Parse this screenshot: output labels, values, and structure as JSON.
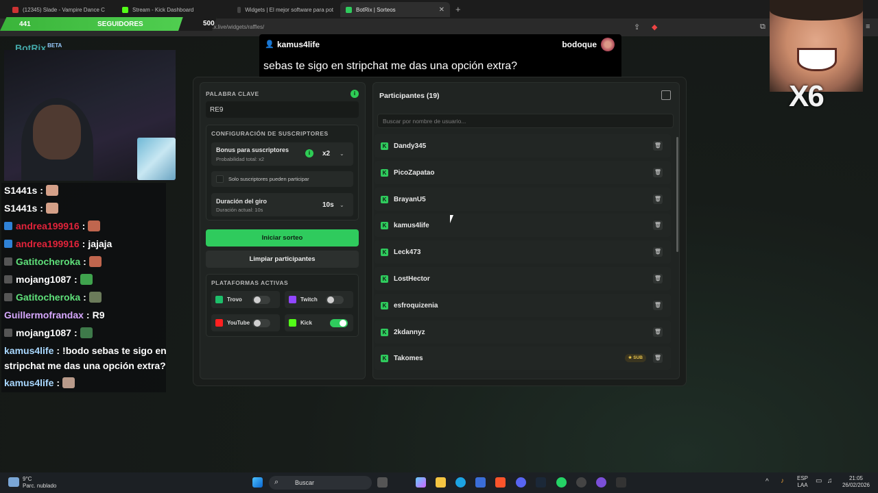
{
  "browser": {
    "tabs": [
      {
        "label": "(12345) Slade - Vampire Dance C"
      },
      {
        "label": "Stream - Kick Dashboard"
      },
      {
        "label": "Widgets | El mejor software para pot"
      },
      {
        "label": "BotRix | Sorteos"
      }
    ],
    "url": "botrix.live/widgets/raffles/"
  },
  "overlay": {
    "followers_count": "441",
    "followers_label": "SEGUIDORES",
    "followers_goal": "500",
    "logo": "BotRix",
    "logo_tag": "BETA",
    "multiplier": "X6"
  },
  "alert": {
    "user": "kamus4life",
    "reward_user": "bodoque",
    "message": "sebas te sigo en stripchat me das una opción extra?"
  },
  "chat": {
    "lines": [
      {
        "user": "S1441s",
        "text": "",
        "color": "#ffffff"
      },
      {
        "user": "S1441s",
        "text": "",
        "color": "#ffffff"
      },
      {
        "user": "andrea199916",
        "text": "",
        "color": "#e2233a"
      },
      {
        "user": "andrea199916",
        "text": "jajaja",
        "color": "#e2233a"
      },
      {
        "user": "Gatitocheroka",
        "text": "",
        "color": "#5fe07a"
      },
      {
        "user": "mojang1087",
        "text": "",
        "color": "#ffffff"
      },
      {
        "user": "Gatitocheroka",
        "text": "",
        "color": "#5fe07a"
      },
      {
        "user": "Guillermofrandax",
        "text": "R9",
        "color": "#d7a8ff"
      },
      {
        "user": "mojang1087",
        "text": "",
        "color": "#ffffff"
      },
      {
        "user": "kamus4life",
        "text": "!bodo sebas te sigo en",
        "color": "#a9d8ff"
      },
      {
        "user": "",
        "text": "stripchat me das una opción extra?",
        "color": "#ffffff"
      },
      {
        "user": "kamus4life",
        "text": "",
        "color": "#a9d8ff"
      }
    ]
  },
  "raffle": {
    "keyword_label": "PALABRA CLAVE",
    "keyword_value": "RE9",
    "subs_config_title": "CONFIGURACIÓN DE SUSCRIPTORES",
    "bonus_title": "Bonus para suscriptores",
    "bonus_sub": "Probabilidad total: x2",
    "bonus_value": "x2",
    "subs_only_label": "Solo suscriptores pueden participar",
    "spin_title": "Duración del giro",
    "spin_sub": "Duración actual: 10s",
    "spin_value": "10s",
    "start_button": "Iniciar sorteo",
    "clear_button": "Limpiar participantes",
    "platforms_title": "PLATAFORMAS ACTIVAS",
    "platforms": [
      {
        "name": "Trovo",
        "enabled": false,
        "color": "#1dbf6a"
      },
      {
        "name": "Twitch",
        "enabled": false,
        "color": "#9146ff"
      },
      {
        "name": "YouTube",
        "enabled": false,
        "color": "#ff2020"
      },
      {
        "name": "Kick",
        "enabled": true,
        "color": "#53fc18"
      }
    ]
  },
  "participants": {
    "title": "Participantes (19)",
    "search_placeholder": "Buscar por nombre de usuario...",
    "items": [
      {
        "name": "Dandy345",
        "badge": ""
      },
      {
        "name": "PicoZapatao",
        "badge": ""
      },
      {
        "name": "BrayanU5",
        "badge": ""
      },
      {
        "name": "kamus4life",
        "badge": ""
      },
      {
        "name": "Leck473",
        "badge": ""
      },
      {
        "name": "LostHector",
        "badge": ""
      },
      {
        "name": "esfroquizenia",
        "badge": ""
      },
      {
        "name": "2kdannyz",
        "badge": ""
      },
      {
        "name": "Takomes",
        "badge": "SUB"
      }
    ]
  },
  "taskbar": {
    "temp": "9°C",
    "weather": "Parc. nublado",
    "search": "Buscar",
    "lang": "ESP",
    "lang2": "LAA",
    "time": "21:05",
    "date": "26/02/2026"
  }
}
